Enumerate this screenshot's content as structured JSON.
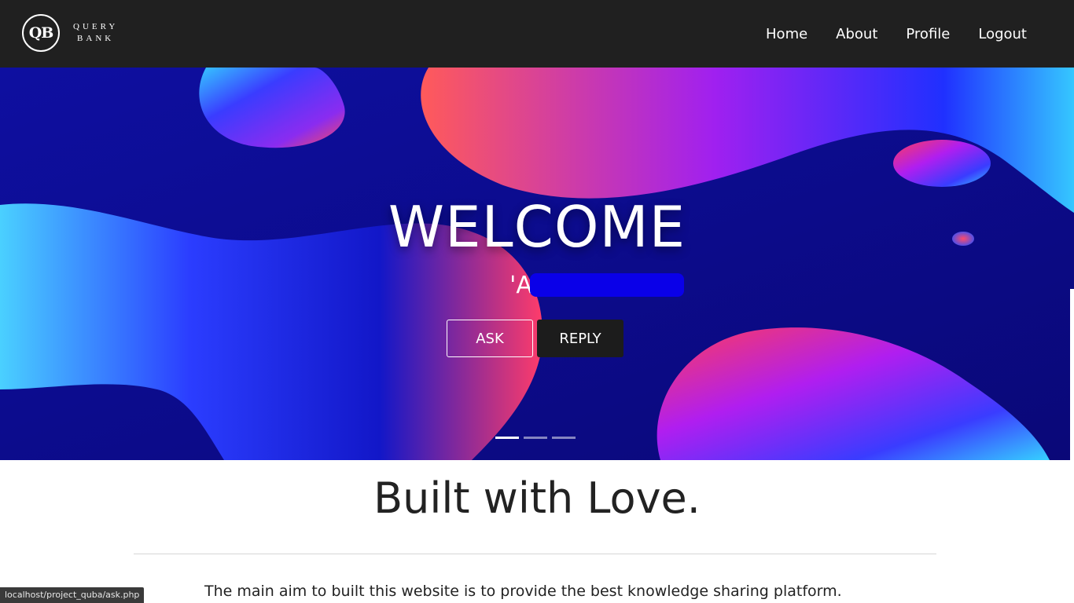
{
  "header": {
    "logo_text": "QB",
    "brand_line1": "QUERY",
    "brand_line2": "BANK",
    "nav": [
      {
        "label": "Home"
      },
      {
        "label": "About"
      },
      {
        "label": "Profile"
      },
      {
        "label": "Logout"
      }
    ]
  },
  "hero": {
    "welcome": "WELCOME",
    "username": "'A                D'",
    "ask_label": "ASK",
    "reply_label": "REPLY",
    "slides": 3,
    "active_slide": 1
  },
  "content": {
    "title": "Built with Love.",
    "paragraph": "The main aim to built this website is to provide the best knowledge sharing platform."
  },
  "status": {
    "url": "localhost/project_quba/ask.php"
  }
}
